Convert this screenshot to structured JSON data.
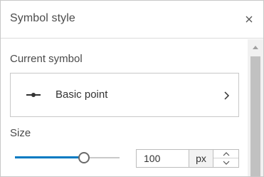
{
  "header": {
    "title": "Symbol style",
    "close_icon": "close-icon"
  },
  "current_symbol": {
    "label": "Current symbol",
    "name": "Basic point",
    "preview_icon": "point-symbol-icon",
    "chevron_icon": "chevron-right-icon"
  },
  "size": {
    "label": "Size",
    "value": "100",
    "unit": "px",
    "slider_fraction": 0.66,
    "up_icon": "chevron-up-icon",
    "down_icon": "chevron-down-icon"
  },
  "colors": {
    "accent": "#007ac2",
    "border": "#c8c8c8",
    "text": "#4a4a4a"
  }
}
